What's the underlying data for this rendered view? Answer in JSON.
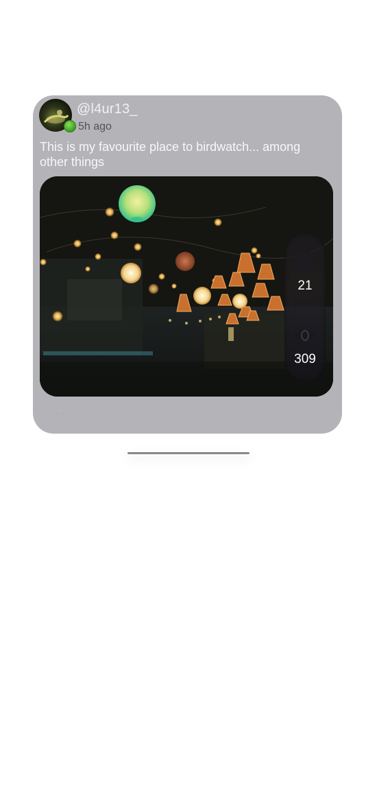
{
  "post": {
    "username": "@l4ur13_",
    "timestamp": "5h ago",
    "caption": "This is my favourite place to birdwatch... among other things",
    "image_description_icon": "photo-image",
    "stats": {
      "likes": "21",
      "views": "309",
      "like_icon": "heart-icon",
      "view_icon": "eye-icon"
    },
    "more_icon": "ellipsis-icon",
    "more_label": "···",
    "online_status_color": "#4caf2f"
  },
  "colors": {
    "card_background": "#b4b3b8",
    "page_background": "#ffffff",
    "username_color": "#f1f1f3",
    "timestamp_color": "#515157"
  }
}
